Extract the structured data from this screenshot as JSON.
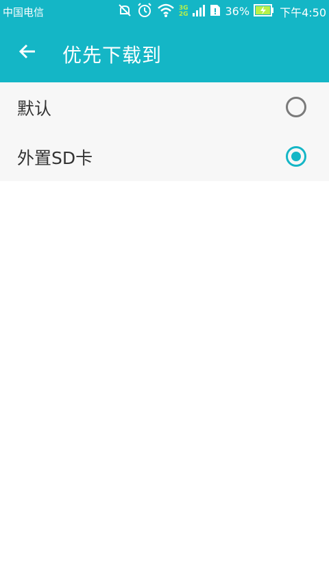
{
  "status_bar": {
    "carrier": "中国电信",
    "network_top": "3G",
    "network_bottom": "2G",
    "battery": "36%",
    "time": "下午4:50",
    "icons": [
      "mute-icon",
      "alarm-icon",
      "wifi-icon",
      "signal-icon",
      "sim-alert-icon",
      "battery-charging-icon"
    ]
  },
  "app_bar": {
    "title": "优先下载到",
    "back_icon": "arrow-left-icon"
  },
  "options": [
    {
      "label": "默认",
      "selected": false
    },
    {
      "label": "外置SD卡",
      "selected": true
    }
  ],
  "colors": {
    "accent": "#14b6c6",
    "list_bg": "#f7f7f7",
    "radio_off": "#7a7a7a"
  }
}
